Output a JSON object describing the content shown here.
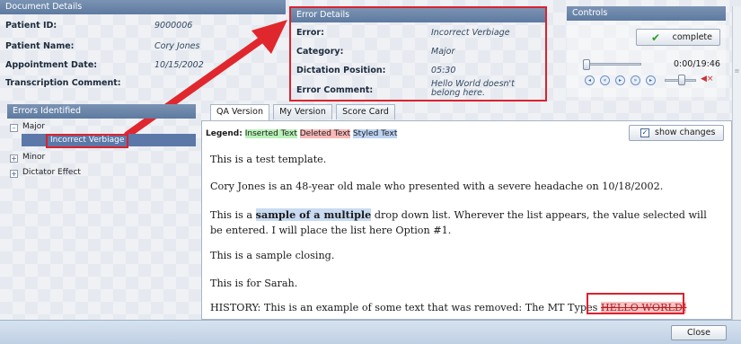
{
  "doc": {
    "title": "Document Details",
    "fields": [
      {
        "label": "Patient ID:",
        "value": "9000006"
      },
      {
        "label": "Patient Name:",
        "value": "Cory Jones"
      },
      {
        "label": "Appointment Date:",
        "value": "10/15/2002"
      },
      {
        "label": "Transcription Comment:",
        "value": ""
      }
    ]
  },
  "error": {
    "title": "Error Details",
    "fields": [
      {
        "label": "Error:",
        "value": "Incorrect Verbiage"
      },
      {
        "label": "Category:",
        "value": "Major"
      },
      {
        "label": "Dictation Position:",
        "value": "05:30"
      },
      {
        "label": "Error Comment:",
        "value": "Hello World doesn't belong here."
      }
    ]
  },
  "controls": {
    "title": "Controls",
    "complete_label": "complete",
    "time_readout": "0:00/19:46"
  },
  "errors_panel": {
    "title": "Errors Identified",
    "items": [
      {
        "label": "Major",
        "toggle": "–"
      },
      {
        "label": "Incorrect Verbiage",
        "toggle": ""
      },
      {
        "label": "Minor",
        "toggle": "+"
      },
      {
        "label": "Dictator Effect",
        "toggle": "+"
      }
    ]
  },
  "tabs": [
    {
      "label": "QA Version",
      "active": true
    },
    {
      "label": "My Version",
      "active": false
    },
    {
      "label": "Score Card",
      "active": false
    }
  ],
  "legend": {
    "label": "Legend:",
    "inserted": "Inserted Text",
    "deleted": "Deleted Text",
    "styled": "Styled Text"
  },
  "show_changes_label": "show changes",
  "document": {
    "p1": "This is a test template.",
    "p2": "Cory Jones is an 48-year old male who presented with a severe headache on 10/18/2002.",
    "p3_before": "This is a ",
    "p3_highlight": "sample of a multiple",
    "p3_after": " drop down list.  Wherever the list appears, the value selected will be entered.  I will place the list here Option #1.",
    "p4": "This is a sample closing.",
    "p5": "This is for Sarah.",
    "p6_before": "HISTORY: This is an example of some text that was removed:  The MT Types ",
    "p6_strike": "HELLO WORLD!"
  },
  "close_label": "Close"
}
